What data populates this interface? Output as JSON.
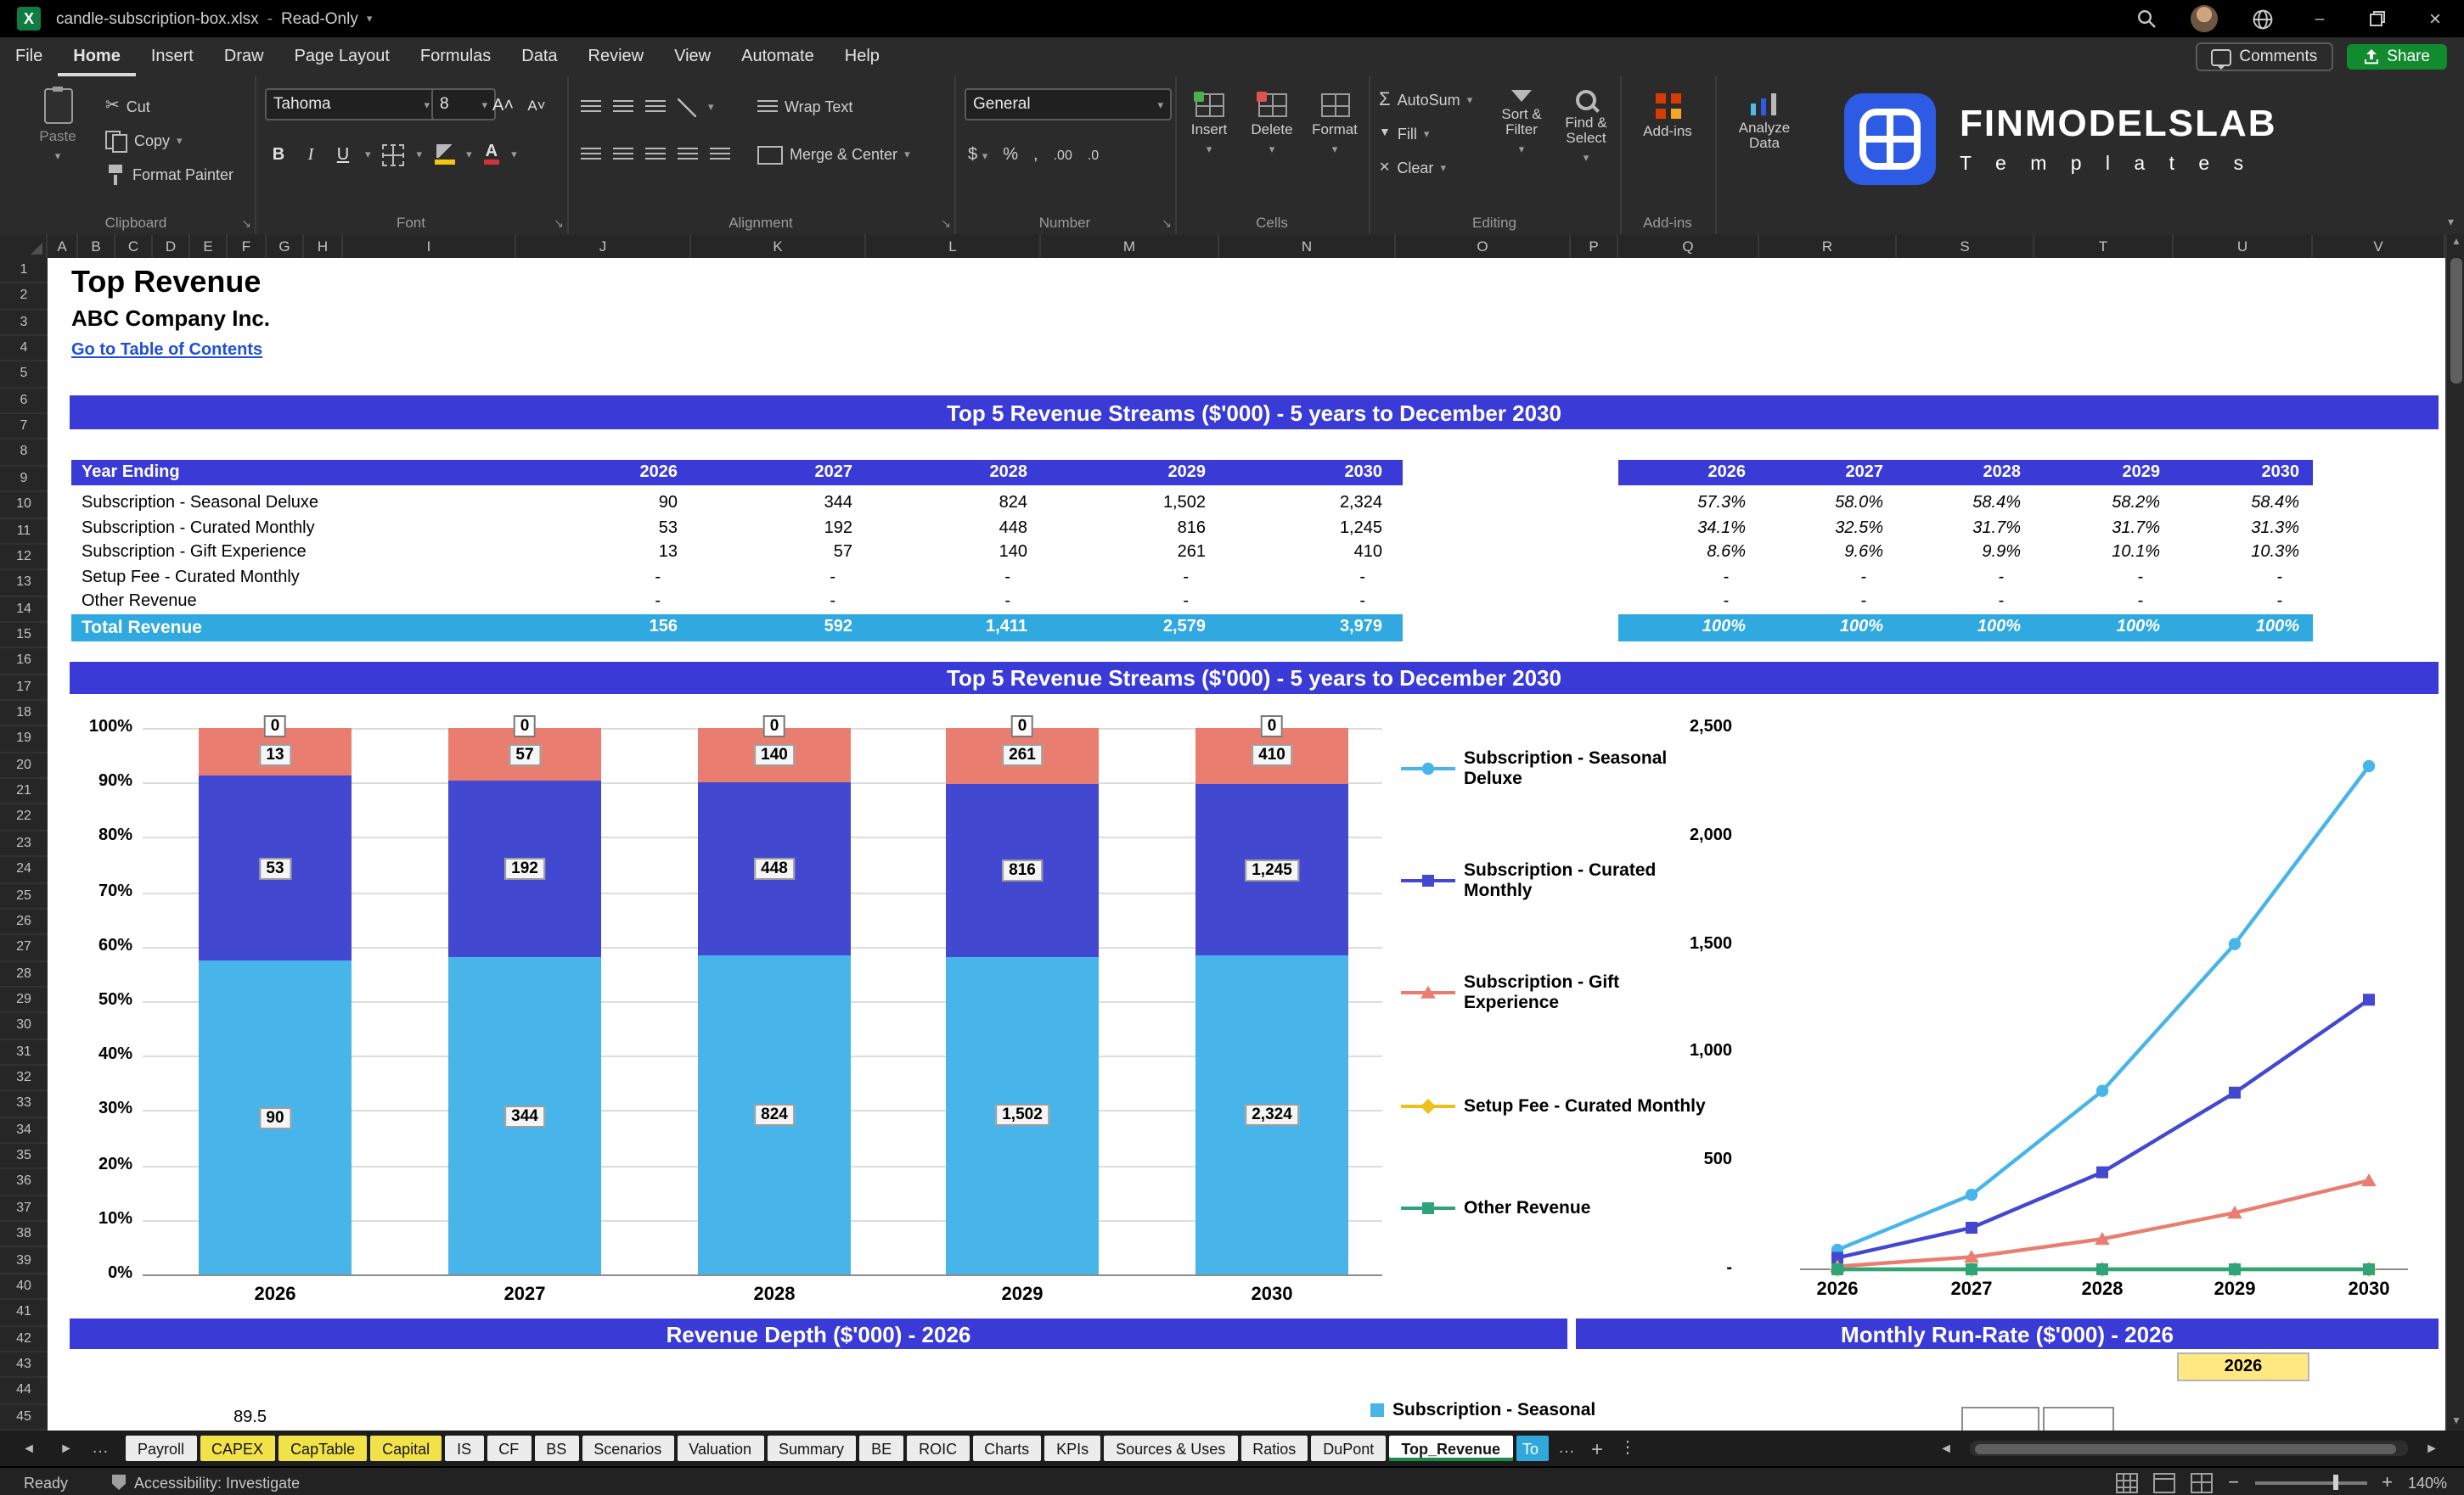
{
  "colors": {
    "banner_blue": "#3A3AD6",
    "total_cyan": "#2FA9E0",
    "series_cyan": "#47B5E9",
    "series_blue": "#4348D0",
    "series_salmon": "#E97E70",
    "series_yellow": "#EEC117",
    "series_green": "#2FA47B",
    "tab_yellow": "#F2E249",
    "cell_yellow": "#FFE880",
    "link_blue": "#1F4FD8",
    "share_green": "#128A2E"
  },
  "icons": {
    "search": "magnifier",
    "globe": "sphere",
    "minimize": "–",
    "restore": "overlapping-windows",
    "close": "×",
    "comments": "speech-bubble",
    "share": "arrow-up-from-box",
    "caret": "▾"
  },
  "titlebar": {
    "title": "candle-subscription-box.xlsx",
    "mode": "Read-Only"
  },
  "menubar": {
    "items": [
      "File",
      "Home",
      "Insert",
      "Draw",
      "Page Layout",
      "Formulas",
      "Data",
      "Review",
      "View",
      "Automate",
      "Help"
    ],
    "active": "Home",
    "comments": "Comments",
    "share": "Share"
  },
  "ribbon": {
    "paste": "Paste",
    "cut": "Cut",
    "copy": "Copy",
    "format_painter": "Format Painter",
    "clipboard_label": "Clipboard",
    "font_name": "Tahoma",
    "font_size": "8",
    "font_label": "Font",
    "wrap_text": "Wrap Text",
    "merge_center": "Merge & Center",
    "alignment_label": "Alignment",
    "number_format": "General",
    "number_label": "Number",
    "insert": "Insert",
    "delete": "Delete",
    "format": "Format",
    "cells_label": "Cells",
    "autosum": "AutoSum",
    "fill": "Fill",
    "clear": "Clear",
    "sort_filter": "Sort & Filter",
    "find_select": "Find & Select",
    "editing_label": "Editing",
    "addins_button": "Add-ins",
    "addins_label": "Add-ins",
    "analyze_data": "Analyze Data",
    "brand_name": "FINMODELSLAB",
    "brand_sub": "T e m p l a t e s"
  },
  "sheet": {
    "columns": [
      "A",
      "B",
      "C",
      "D",
      "E",
      "F",
      "G",
      "H",
      "I",
      "J",
      "K",
      "L",
      "M",
      "N",
      "O",
      "P",
      "Q",
      "R",
      "S",
      "T",
      "U",
      "V"
    ],
    "row_count": 45,
    "title": "Top Revenue",
    "company": "ABC Company Inc.",
    "toc_link": "Go to Table of Contents",
    "banner_table": "Top 5 Revenue Streams ($'000) - 5 years to December 2030",
    "banner_chart": "Top 5 Revenue Streams ($'000) - 5 years to December 2030",
    "banner_depth": "Revenue Depth ($'000) - 2026",
    "banner_runrate": "Monthly Run-Rate ($'000) - 2026",
    "runrate_year": "2026",
    "partial_axis_value": "89.5",
    "partial_legend": "Subscription - Seasonal"
  },
  "revenue_table": {
    "header_label": "Year Ending",
    "years": [
      "2026",
      "2027",
      "2028",
      "2029",
      "2030"
    ],
    "rows": [
      {
        "label": "Subscription - Seasonal Deluxe",
        "values": [
          "90",
          "344",
          "824",
          "1,502",
          "2,324"
        ],
        "pct": [
          "57.3%",
          "58.0%",
          "58.4%",
          "58.2%",
          "58.4%"
        ]
      },
      {
        "label": "Subscription - Curated Monthly",
        "values": [
          "53",
          "192",
          "448",
          "816",
          "1,245"
        ],
        "pct": [
          "34.1%",
          "32.5%",
          "31.7%",
          "31.7%",
          "31.3%"
        ]
      },
      {
        "label": "Subscription - Gift Experience",
        "values": [
          "13",
          "57",
          "140",
          "261",
          "410"
        ],
        "pct": [
          "8.6%",
          "9.6%",
          "9.9%",
          "10.1%",
          "10.3%"
        ]
      },
      {
        "label": "Setup Fee - Curated Monthly",
        "values": [
          "-",
          "-",
          "-",
          "-",
          "-"
        ],
        "pct": [
          "-",
          "-",
          "-",
          "-",
          "-"
        ]
      },
      {
        "label": "Other Revenue",
        "values": [
          "-",
          "-",
          "-",
          "-",
          "-"
        ],
        "pct": [
          "-",
          "-",
          "-",
          "-",
          "-"
        ]
      }
    ],
    "total": {
      "label": "Total Revenue",
      "values": [
        "156",
        "592",
        "1,411",
        "2,579",
        "3,979"
      ],
      "pct": [
        "100%",
        "100%",
        "100%",
        "100%",
        "100%"
      ]
    }
  },
  "chart_data": [
    {
      "type": "bar",
      "subtype": "stacked-100-percent",
      "title": "Top 5 Revenue Streams ($'000) - 5 years to December 2030",
      "categories": [
        "2026",
        "2027",
        "2028",
        "2029",
        "2030"
      ],
      "series": [
        {
          "name": "Subscription - Seasonal Deluxe",
          "values": [
            90,
            344,
            824,
            1502,
            2324
          ],
          "shares_pct": [
            57.3,
            58.0,
            58.4,
            58.2,
            58.4
          ],
          "color": "#47B5E9",
          "marker": "circle"
        },
        {
          "name": "Subscription - Curated Monthly",
          "values": [
            53,
            192,
            448,
            816,
            1245
          ],
          "shares_pct": [
            34.1,
            32.5,
            31.7,
            31.7,
            31.3
          ],
          "color": "#4348D0",
          "marker": "square"
        },
        {
          "name": "Subscription - Gift Experience",
          "values": [
            13,
            57,
            140,
            261,
            410
          ],
          "shares_pct": [
            8.6,
            9.6,
            9.9,
            10.1,
            10.3
          ],
          "color": "#E97E70",
          "marker": "triangle"
        },
        {
          "name": "Setup Fee - Curated Monthly",
          "values": [
            0,
            0,
            0,
            0,
            0
          ],
          "shares_pct": [
            0,
            0,
            0,
            0,
            0
          ],
          "color": "#EEC117",
          "marker": "diamond"
        },
        {
          "name": "Other Revenue",
          "values": [
            0,
            0,
            0,
            0,
            0
          ],
          "shares_pct": [
            0,
            0,
            0,
            0,
            0
          ],
          "color": "#2FA47B",
          "marker": "square"
        }
      ],
      "bar_top_label": "0",
      "y_axis": {
        "min": 0,
        "max": 100,
        "step": 10,
        "format": "percent",
        "labels": [
          "0%",
          "10%",
          "20%",
          "30%",
          "40%",
          "50%",
          "60%",
          "70%",
          "80%",
          "90%",
          "100%"
        ]
      },
      "legend_position": "right",
      "grid": true
    },
    {
      "type": "line",
      "categories": [
        "2026",
        "2027",
        "2028",
        "2029",
        "2030"
      ],
      "series": [
        {
          "name": "Subscription - Seasonal Deluxe",
          "values": [
            90,
            344,
            824,
            1502,
            2324
          ],
          "color": "#47B5E9",
          "marker": "circle"
        },
        {
          "name": "Subscription - Curated Monthly",
          "values": [
            53,
            192,
            448,
            816,
            1245
          ],
          "color": "#4348D0",
          "marker": "square"
        },
        {
          "name": "Subscription - Gift Experience",
          "values": [
            13,
            57,
            140,
            261,
            410
          ],
          "color": "#E97E70",
          "marker": "triangle"
        },
        {
          "name": "Setup Fee - Curated Monthly",
          "values": [
            0,
            0,
            0,
            0,
            0
          ],
          "color": "#EEC117",
          "marker": "diamond"
        },
        {
          "name": "Other Revenue",
          "values": [
            0,
            0,
            0,
            0,
            0
          ],
          "color": "#2FA47B",
          "marker": "square"
        }
      ],
      "y_axis": {
        "min": 0,
        "max": 2500,
        "step": 500,
        "labels": [
          "-",
          "500",
          "1,000",
          "1,500",
          "2,000",
          "2,500"
        ],
        "tick_values": [
          0,
          500,
          1000,
          1500,
          2000,
          2500
        ]
      },
      "grid": false
    }
  ],
  "tabs": {
    "list": [
      {
        "label": "Payroll",
        "color": "white"
      },
      {
        "label": "CAPEX",
        "color": "yellow"
      },
      {
        "label": "CapTable",
        "color": "yellow"
      },
      {
        "label": "Capital",
        "color": "yellow"
      },
      {
        "label": "IS",
        "color": "white"
      },
      {
        "label": "CF",
        "color": "white"
      },
      {
        "label": "BS",
        "color": "white"
      },
      {
        "label": "Scenarios",
        "color": "white"
      },
      {
        "label": "Valuation",
        "color": "white"
      },
      {
        "label": "Summary",
        "color": "white"
      },
      {
        "label": "BE",
        "color": "white"
      },
      {
        "label": "ROIC",
        "color": "white"
      },
      {
        "label": "Charts",
        "color": "white"
      },
      {
        "label": "KPIs",
        "color": "white"
      },
      {
        "label": "Sources & Uses",
        "color": "white"
      },
      {
        "label": "Ratios",
        "color": "white"
      },
      {
        "label": "DuPont",
        "color": "white"
      },
      {
        "label": "Top_Revenue",
        "color": "white",
        "active": true
      },
      {
        "label": "To",
        "color": "blue"
      }
    ]
  },
  "statusbar": {
    "ready": "Ready",
    "accessibility": "Accessibility: Investigate",
    "zoom": "140%"
  }
}
